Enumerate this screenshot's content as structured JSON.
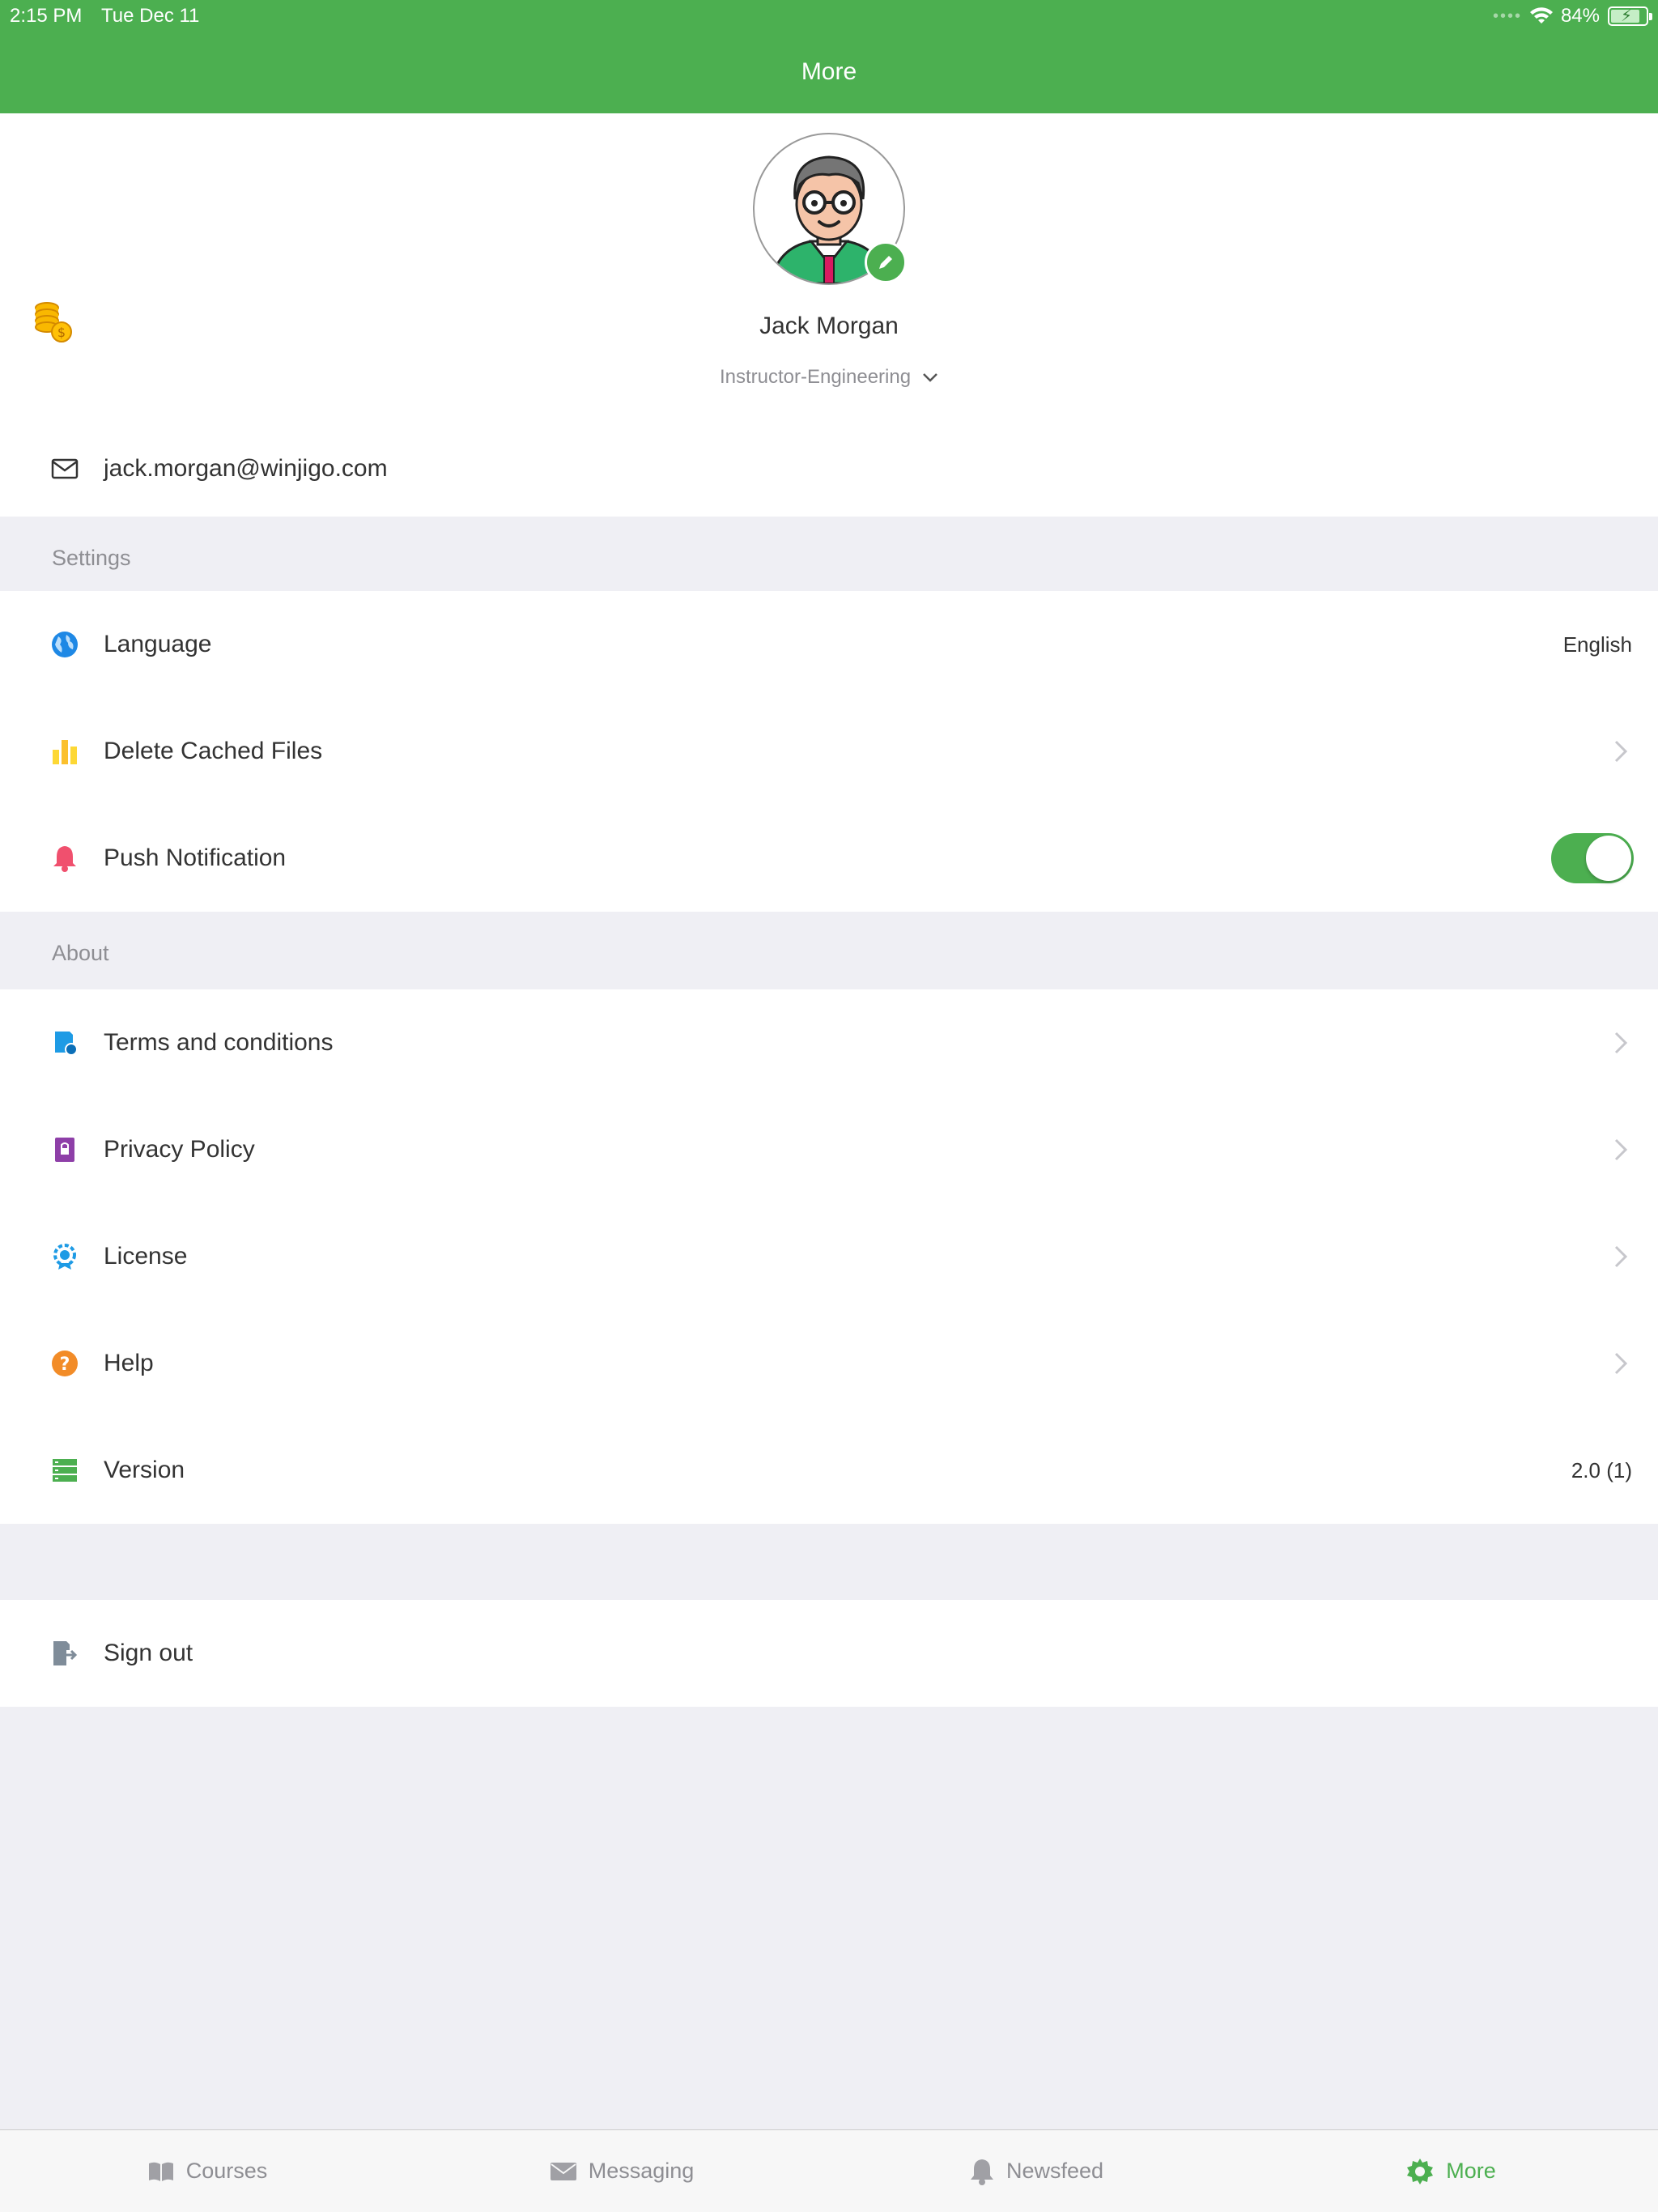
{
  "status_bar": {
    "time": "2:15 PM",
    "date": "Tue Dec 11",
    "battery_percent": "84%",
    "battery_level": 0.84
  },
  "header": {
    "title": "More"
  },
  "profile": {
    "name": "Jack Morgan",
    "role": "Instructor-Engineering",
    "email": "jack.morgan@winjigo.com"
  },
  "settings": {
    "section_title": "Settings",
    "items": [
      {
        "label": "Language",
        "value": "English",
        "icon": "globe-icon"
      },
      {
        "label": "Delete Cached Files",
        "icon": "bar-chart-icon"
      },
      {
        "label": "Push Notification",
        "icon": "bell-icon",
        "toggle_on": true
      }
    ]
  },
  "about": {
    "section_title": "About",
    "items": [
      {
        "label": "Terms and conditions",
        "icon": "document-shield-icon"
      },
      {
        "label": "Privacy Policy",
        "icon": "lock-document-icon"
      },
      {
        "label": "License",
        "icon": "badge-icon"
      },
      {
        "label": "Help",
        "icon": "help-icon"
      },
      {
        "label": "Version",
        "value": "2.0 (1)",
        "icon": "server-icon"
      }
    ]
  },
  "sign_out": {
    "label": "Sign out",
    "icon": "sign-out-icon"
  },
  "tabbar": {
    "tabs": [
      {
        "label": "Courses",
        "icon": "book-icon"
      },
      {
        "label": "Messaging",
        "icon": "envelope-icon"
      },
      {
        "label": "Newsfeed",
        "icon": "bell-icon"
      },
      {
        "label": "More",
        "icon": "gear-icon",
        "active": true
      }
    ]
  },
  "colors": {
    "brand": "#4caf50",
    "background": "#efeff4",
    "muted_text": "#8e8e93"
  }
}
